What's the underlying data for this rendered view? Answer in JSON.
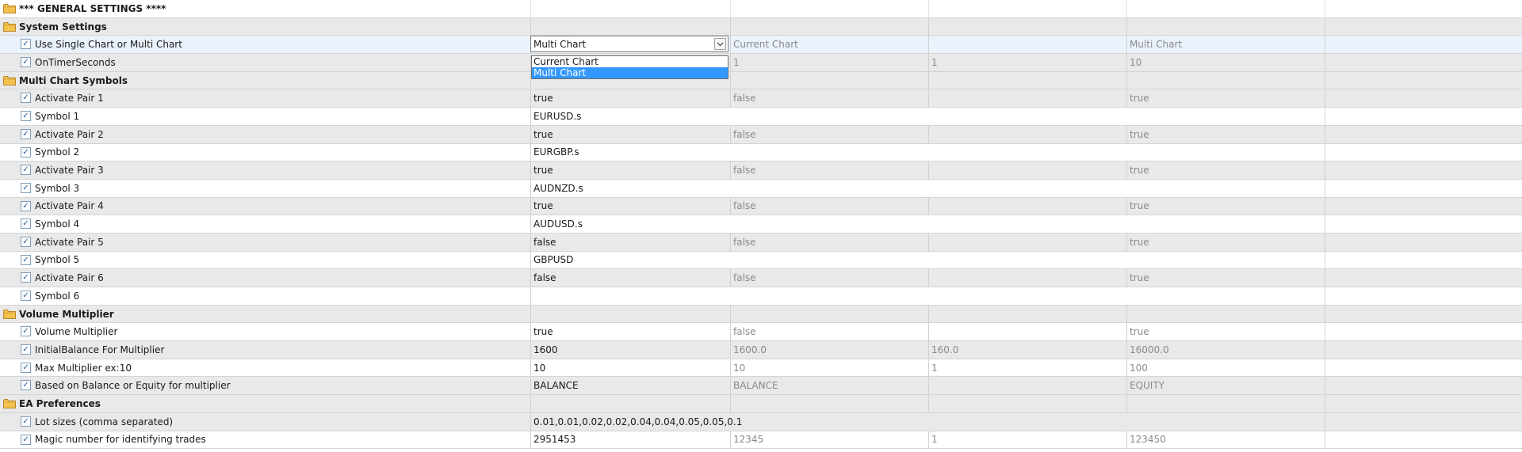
{
  "rows": [
    {
      "kind": "group",
      "label": "*** GENERAL SETTINGS ****",
      "top": true
    },
    {
      "kind": "group",
      "label": "System Settings"
    },
    {
      "kind": "param",
      "label": "Use Single Chart or Multi Chart",
      "value": "Multi Chart",
      "start": "Current Chart",
      "step": "",
      "stop": "Multi Chart",
      "combo": true,
      "selected": true
    },
    {
      "kind": "param",
      "label": "OnTimerSeconds",
      "value": "",
      "start": "1",
      "step": "1",
      "stop": "10",
      "shade": true
    },
    {
      "kind": "group",
      "label": "Multi Chart Symbols"
    },
    {
      "kind": "param",
      "label": "Activate Pair 1",
      "value": "true",
      "start": "false",
      "step": "",
      "stop": "true",
      "shade": true
    },
    {
      "kind": "param",
      "label": "Symbol 1",
      "value": "EURUSD.s",
      "wide": true
    },
    {
      "kind": "param",
      "label": "Activate Pair 2",
      "value": "true",
      "start": "false",
      "step": "",
      "stop": "true",
      "shade": true
    },
    {
      "kind": "param",
      "label": "Symbol 2",
      "value": "EURGBP.s",
      "wide": true
    },
    {
      "kind": "param",
      "label": "Activate Pair 3",
      "value": "true",
      "start": "false",
      "step": "",
      "stop": "true",
      "shade": true
    },
    {
      "kind": "param",
      "label": "Symbol 3",
      "value": "AUDNZD.s",
      "wide": true
    },
    {
      "kind": "param",
      "label": "Activate Pair 4",
      "value": "true",
      "start": "false",
      "step": "",
      "stop": "true",
      "shade": true
    },
    {
      "kind": "param",
      "label": "Symbol 4",
      "value": "AUDUSD.s",
      "wide": true
    },
    {
      "kind": "param",
      "label": "Activate Pair 5",
      "value": "false",
      "start": "false",
      "step": "",
      "stop": "true",
      "shade": true
    },
    {
      "kind": "param",
      "label": "Symbol 5",
      "value": "GBPUSD",
      "wide": true
    },
    {
      "kind": "param",
      "label": "Activate Pair 6",
      "value": "false",
      "start": "false",
      "step": "",
      "stop": "true",
      "shade": true
    },
    {
      "kind": "param",
      "label": "Symbol 6",
      "value": "",
      "wide": true
    },
    {
      "kind": "group",
      "label": "Volume Multiplier"
    },
    {
      "kind": "param",
      "label": "Volume Multiplier",
      "value": "true",
      "start": "false",
      "step": "",
      "stop": "true"
    },
    {
      "kind": "param",
      "label": "InitialBalance For Multiplier",
      "value": "1600",
      "start": "1600.0",
      "step": "160.0",
      "stop": "16000.0",
      "shade": true
    },
    {
      "kind": "param",
      "label": "Max Multiplier ex:10",
      "value": "10",
      "start": "10",
      "step": "1",
      "stop": "100"
    },
    {
      "kind": "param",
      "label": "Based on Balance or Equity for multiplier",
      "value": "BALANCE",
      "start": "BALANCE",
      "step": "",
      "stop": "EQUITY",
      "shade": true
    },
    {
      "kind": "group",
      "label": "EA Preferences"
    },
    {
      "kind": "param",
      "label": "Lot sizes (comma separated)",
      "value": "0.01,0.01,0.02,0.02,0.04,0.04,0.05,0.05,0.1",
      "wide": true,
      "shade": true
    },
    {
      "kind": "param",
      "label": "Magic number for identifying trades",
      "value": "2951453",
      "start": "12345",
      "step": "1",
      "stop": "123450"
    }
  ],
  "dropdown": {
    "options": [
      "Current Chart",
      "Multi Chart"
    ],
    "active_index": 1
  },
  "icons": {
    "group": "folder-icon",
    "param": "checkbox-checked-icon",
    "combo": "chevron-down-icon"
  },
  "colors": {
    "selection": "#3399ff",
    "folder": "#f2c14e"
  }
}
